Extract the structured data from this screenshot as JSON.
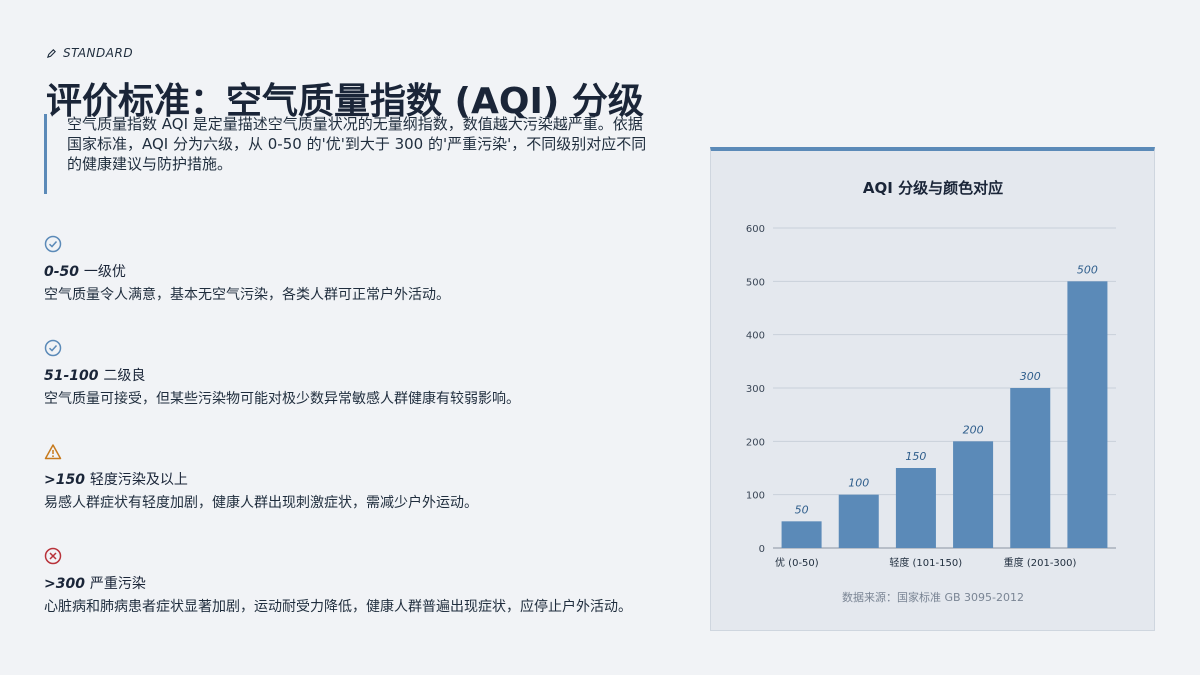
{
  "header": {
    "eyebrow": "STANDARD",
    "title": "评价标准：空气质量指数 (AQI) 分级",
    "intro": "空气质量指数 AQI 是定量描述空气质量状况的无量纲指数，数值越大污染越严重。依据国家标准，AQI 分为六级，从 0-50 的'优'到大于 300 的'严重污染'，不同级别对应不同的健康建议与防护措施。"
  },
  "levels": [
    {
      "icon": "check-circle-icon",
      "range": "0-50",
      "name": "一级优",
      "desc": "空气质量令人满意，基本无空气污染，各类人群可正常户外活动。",
      "color": "#5b8ab8"
    },
    {
      "icon": "check-circle-icon",
      "range": "51-100",
      "name": "二级良",
      "desc": "空气质量可接受，但某些污染物可能对极少数异常敏感人群健康有较弱影响。",
      "color": "#5b8ab8"
    },
    {
      "icon": "warning-triangle-icon",
      "range": ">150",
      "name": "轻度污染及以上",
      "desc": "易感人群症状有轻度加剧，健康人群出现刺激症状，需减少户外运动。",
      "color": "#c77a1d"
    },
    {
      "icon": "x-circle-icon",
      "range": ">300",
      "name": "严重污染",
      "desc": "心脏病和肺病患者症状显著加剧，运动耐受力降低，健康人群普遍出现症状，应停止户外活动。",
      "color": "#b8323a"
    }
  ],
  "chart_data": {
    "type": "bar",
    "title": "AQI 分级与颜色对应",
    "categories": [
      "优 (0-50)",
      "",
      "轻度 (101-150)",
      "",
      "重度 (201-300)",
      ""
    ],
    "values": [
      50,
      100,
      150,
      200,
      300,
      500
    ],
    "ylim": [
      0,
      600
    ],
    "yticks": [
      0,
      100,
      200,
      300,
      400,
      500,
      600
    ],
    "grid": true,
    "bar_color": "#5b8ab8",
    "source": "数据来源：国家标准 GB 3095-2012"
  }
}
